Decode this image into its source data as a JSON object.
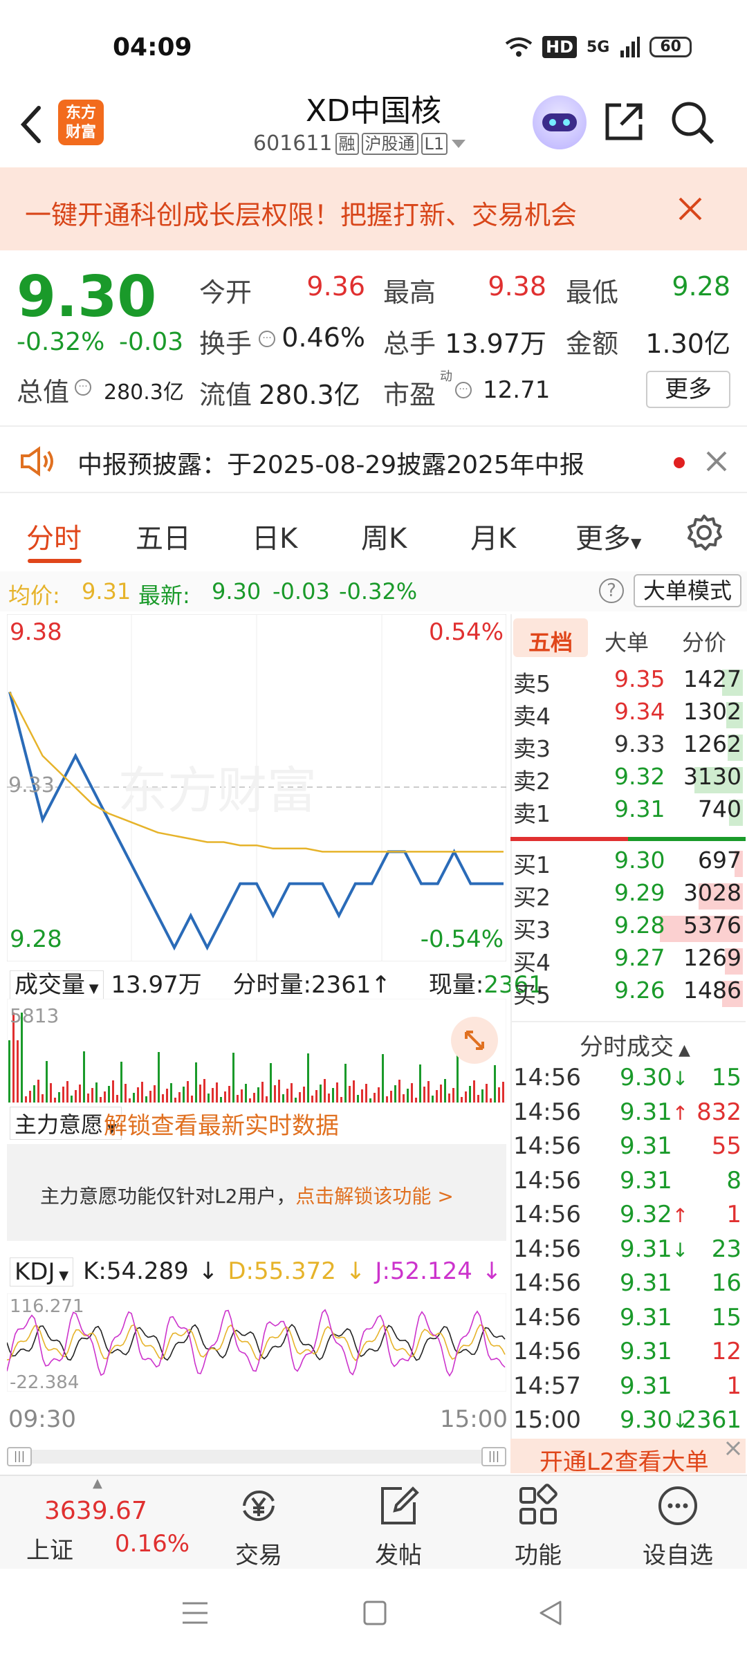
{
  "status": {
    "time": "04:09",
    "network": "5G",
    "hd": "HD",
    "battery": "60"
  },
  "header": {
    "logo_line1": "东方",
    "logo_line2": "财富",
    "title": "XD中国核",
    "code": "601611",
    "tags": [
      "融",
      "沪股通",
      "L1"
    ]
  },
  "banner": {
    "text": "一键开通科创成长层权限！把握打新、交易机会"
  },
  "quote": {
    "price": "9.30",
    "change_pct": "-0.32%",
    "change": "-0.03",
    "open_label": "今开",
    "open": "9.36",
    "high_label": "最高",
    "high": "9.38",
    "low_label": "最低",
    "low": "9.28",
    "turnover_label": "换手",
    "turnover": "0.46%",
    "volume_label": "总手",
    "volume": "13.97万",
    "amount_label": "金额",
    "amount": "1.30亿",
    "mktcap_label": "总值",
    "mktcap": "280.3亿",
    "float_label": "流值",
    "float": "280.3亿",
    "pe_label": "市盈",
    "pe_sup": "动",
    "pe": "12.71",
    "more": "更多"
  },
  "notice": {
    "text": "中报预披露：于2025-08-29披露2025年中报"
  },
  "tabs": [
    "分时",
    "五日",
    "日K",
    "周K",
    "月K",
    "更多"
  ],
  "avg": {
    "avg_label": "均价:",
    "avg": "9.31",
    "last_label": "最新:",
    "last": "9.30",
    "chg": "-0.03",
    "pct": "-0.32%",
    "big_mode": "大单模式"
  },
  "chart": {
    "high": "9.38",
    "low": "9.28",
    "pct_high": "0.54%",
    "pct_low": "-0.54%",
    "ref": "9.33",
    "watermark": "东方财富",
    "vol_label": "成交量",
    "vol_total": "13.97万",
    "tick_vol": "分时量:2361",
    "cur_vol_label": "现量:",
    "cur_vol": "2361",
    "vol_max": "5813",
    "main_label": "主力意愿",
    "main_unlock": "解锁查看最新实时数据",
    "l2_note": "主力意愿功能仅针对L2用户，",
    "l2_link": "点击解锁该功能 >",
    "kdj_label": "KDJ",
    "k": "K:54.289",
    "d": "D:55.372",
    "j": "J:52.124",
    "kdj_max": "116.271",
    "kdj_min": "-22.384",
    "t_start": "09:30",
    "t_end": "15:00"
  },
  "chart_data": {
    "type": "line",
    "x_range": [
      "09:30",
      "15:00"
    ],
    "ylim": [
      9.28,
      9.38
    ],
    "series": [
      {
        "name": "最新",
        "values": [
          9.36,
          9.34,
          9.32,
          9.33,
          9.34,
          9.33,
          9.32,
          9.31,
          9.3,
          9.29,
          9.28,
          9.29,
          9.28,
          9.29,
          9.3,
          9.3,
          9.29,
          9.3,
          9.3,
          9.3,
          9.29,
          9.3,
          9.3,
          9.31,
          9.31,
          9.3,
          9.3,
          9.31,
          9.3,
          9.3,
          9.3
        ]
      },
      {
        "name": "均价",
        "values": [
          9.36,
          9.35,
          9.34,
          9.335,
          9.33,
          9.325,
          9.322,
          9.32,
          9.318,
          9.316,
          9.315,
          9.314,
          9.313,
          9.313,
          9.312,
          9.312,
          9.311,
          9.311,
          9.311,
          9.31,
          9.31,
          9.31,
          9.31,
          9.31,
          9.31,
          9.31,
          9.31,
          9.31,
          9.31,
          9.31,
          9.31
        ]
      }
    ]
  },
  "panel": {
    "tabs": [
      "五档",
      "大单",
      "分价"
    ],
    "asks": [
      {
        "label": "卖5",
        "price": "9.35",
        "vol": "1427",
        "color": "red",
        "bar": 0.15
      },
      {
        "label": "卖4",
        "price": "9.34",
        "vol": "1302",
        "color": "red",
        "bar": 0.12
      },
      {
        "label": "卖3",
        "price": "9.33",
        "vol": "1262",
        "color": "gray",
        "bar": 0.11
      },
      {
        "label": "卖2",
        "price": "9.32",
        "vol": "3130",
        "color": "green",
        "bar": 0.35
      },
      {
        "label": "卖1",
        "price": "9.31",
        "vol": "740",
        "color": "green",
        "bar": 0.1
      }
    ],
    "bids": [
      {
        "label": "买1",
        "price": "9.30",
        "vol": "697",
        "color": "green",
        "bar": 0.06
      },
      {
        "label": "买2",
        "price": "9.29",
        "vol": "3028",
        "color": "green",
        "bar": 0.32
      },
      {
        "label": "买3",
        "price": "9.28",
        "vol": "5376",
        "color": "green",
        "bar": 0.6
      },
      {
        "label": "买4",
        "price": "9.27",
        "vol": "1269",
        "color": "green",
        "bar": 0.13
      },
      {
        "label": "买5",
        "price": "9.26",
        "vol": "1486",
        "color": "green",
        "bar": 0.15
      }
    ],
    "trades_title": "分时成交",
    "trades": [
      {
        "t": "14:56",
        "p": "9.30",
        "dir": "down",
        "v": "15",
        "vc": "green",
        "pc": "green"
      },
      {
        "t": "14:56",
        "p": "9.31",
        "dir": "up",
        "v": "832",
        "vc": "red",
        "pc": "green"
      },
      {
        "t": "14:56",
        "p": "9.31",
        "dir": "",
        "v": "55",
        "vc": "red",
        "pc": "green"
      },
      {
        "t": "14:56",
        "p": "9.31",
        "dir": "",
        "v": "8",
        "vc": "green",
        "pc": "green"
      },
      {
        "t": "14:56",
        "p": "9.32",
        "dir": "up",
        "v": "1",
        "vc": "red",
        "pc": "green"
      },
      {
        "t": "14:56",
        "p": "9.31",
        "dir": "down",
        "v": "23",
        "vc": "green",
        "pc": "green"
      },
      {
        "t": "14:56",
        "p": "9.31",
        "dir": "",
        "v": "16",
        "vc": "green",
        "pc": "green"
      },
      {
        "t": "14:56",
        "p": "9.31",
        "dir": "",
        "v": "15",
        "vc": "green",
        "pc": "green"
      },
      {
        "t": "14:56",
        "p": "9.31",
        "dir": "",
        "v": "12",
        "vc": "red",
        "pc": "green"
      },
      {
        "t": "14:57",
        "p": "9.31",
        "dir": "",
        "v": "1",
        "vc": "red",
        "pc": "green"
      },
      {
        "t": "15:00",
        "p": "9.30",
        "dir": "down",
        "v": "2361",
        "vc": "green",
        "pc": "green"
      }
    ],
    "l2_cta": "开通L2查看大单"
  },
  "nav": {
    "index_value": "3639.67",
    "index_name": "上证",
    "index_pct": "0.16%",
    "items": [
      "交易",
      "发帖",
      "功能",
      "设自选"
    ]
  },
  "colors": {
    "up": "#e03030",
    "down": "#1a9a2a",
    "accent": "#e0461a",
    "avg_line": "#e6b32a",
    "price_line": "#2a6bb8"
  }
}
